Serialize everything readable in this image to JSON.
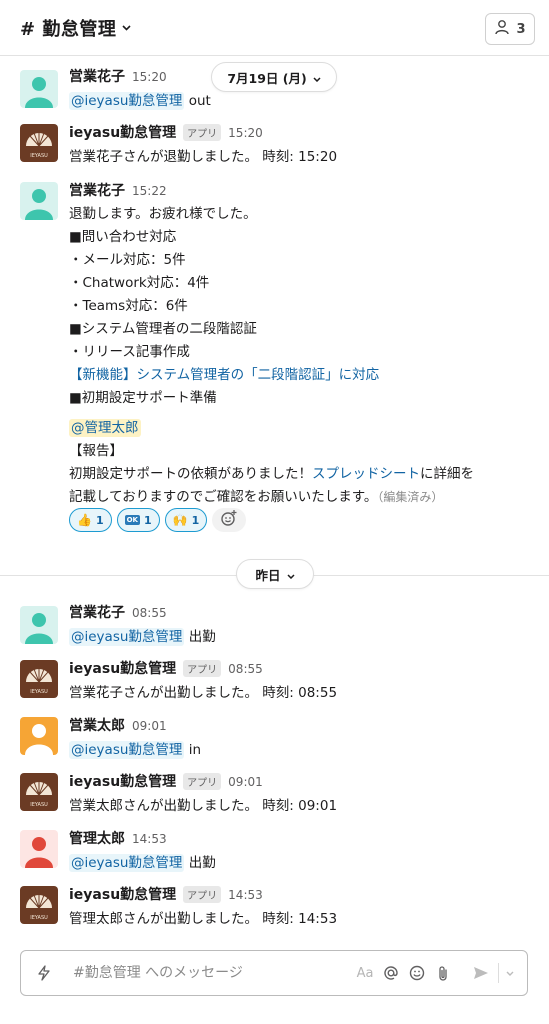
{
  "header": {
    "channel_name": "# 勤怠管理",
    "member_count": "3"
  },
  "dividers": {
    "first_date": "7月19日 (月)",
    "second_date": "昨日"
  },
  "messages": [
    {
      "name": "営業花子",
      "time": "15:20",
      "mention": "@ieyasu勤怠管理",
      "text": " out"
    },
    {
      "name": "ieyasu勤怠管理",
      "badge": "アプリ",
      "time": "15:20",
      "text": "営業花子さんが退勤しました。 時刻: 15:20"
    },
    {
      "name": "営業花子",
      "time": "15:22",
      "lines": [
        "退勤します。お疲れ様でした。",
        "■問い合わせ対応",
        "・メール対応：5件",
        "・Chatwork対応：4件",
        "・Teams対応：6件",
        "■システム管理者の二段階認証",
        "・リリース記事作成",
        "【新機能】システム管理者の「二段階認証」に対応",
        "■初期設定サポート準備"
      ],
      "mention_user": "@管理太郎",
      "report_heading": "【報告】",
      "report_line1_a": "初期設定サポートの依頼がありました！",
      "report_line1_link": "スプレッドシート",
      "report_line1_b": "に詳細を",
      "report_line2": "記載しておりますのでご確認をお願いいたします。",
      "edited": "（編集済み）",
      "reactions": [
        {
          "emoji": "thumbs-up",
          "count": "1"
        },
        {
          "emoji": "ok",
          "count": "1"
        },
        {
          "emoji": "raised-hands",
          "count": "1"
        }
      ]
    },
    {
      "name": "営業花子",
      "time": "08:55",
      "mention": "@ieyasu勤怠管理",
      "text": " 出勤"
    },
    {
      "name": "ieyasu勤怠管理",
      "badge": "アプリ",
      "time": "08:55",
      "text": "営業花子さんが出勤しました。 時刻: 08:55"
    },
    {
      "name": "営業太郎",
      "time": "09:01",
      "mention": "@ieyasu勤怠管理",
      "text": " in"
    },
    {
      "name": "ieyasu勤怠管理",
      "badge": "アプリ",
      "time": "09:01",
      "text": "営業太郎さんが出勤しました。 時刻: 09:01"
    },
    {
      "name": "管理太郎",
      "time": "14:53",
      "mention": "@ieyasu勤怠管理",
      "text": " 出勤"
    },
    {
      "name": "ieyasu勤怠管理",
      "badge": "アプリ",
      "time": "14:53",
      "text": "管理太郎さんが出勤しました。 時刻: 14:53"
    }
  ],
  "bot_logo_text": "IEYASU",
  "composer": {
    "placeholder": "#勤怠管理 へのメッセージ",
    "format_label": "Aa"
  },
  "colors": {
    "link": "#1264a3",
    "reaction_border": "#1d9bd1",
    "avatar_teal": "#3ec5ad",
    "avatar_orange": "#f6a535",
    "avatar_red": "#e0483b",
    "bot_brown": "#6b3b24"
  }
}
